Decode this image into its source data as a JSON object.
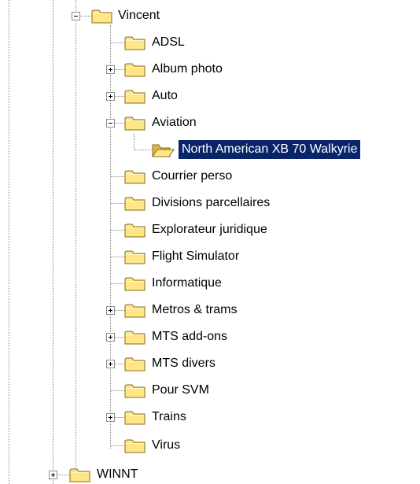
{
  "colors": {
    "selection_bg": "#0a246a",
    "selection_text": "#ffffff",
    "folder_fill": "#ffe788",
    "folder_outline": "#8a6a14",
    "connector": "#8a8a8a"
  },
  "tree": {
    "parent": {
      "label": "Vincent",
      "expander": "collapse",
      "icon": "folder-icon"
    },
    "children": [
      {
        "label": "ADSL",
        "expander": "none",
        "icon": "folder-icon"
      },
      {
        "label": "Album photo",
        "expander": "expand",
        "icon": "folder-icon"
      },
      {
        "label": "Auto",
        "expander": "expand",
        "icon": "folder-icon"
      },
      {
        "label": "Aviation",
        "expander": "collapse",
        "icon": "folder-icon"
      },
      {
        "label": "North American XB 70 Walkyrie",
        "expander": "none",
        "icon": "open-folder-icon",
        "selected": true
      },
      {
        "label": "Courrier perso",
        "expander": "none",
        "icon": "folder-icon"
      },
      {
        "label": "Divisions parcellaires",
        "expander": "none",
        "icon": "folder-icon"
      },
      {
        "label": "Explorateur juridique",
        "expander": "none",
        "icon": "folder-icon"
      },
      {
        "label": "Flight Simulator",
        "expander": "none",
        "icon": "folder-icon"
      },
      {
        "label": "Informatique",
        "expander": "none",
        "icon": "folder-icon"
      },
      {
        "label": "Metros & trams",
        "expander": "expand",
        "icon": "folder-icon"
      },
      {
        "label": "MTS add-ons",
        "expander": "expand",
        "icon": "folder-icon"
      },
      {
        "label": "MTS divers",
        "expander": "expand",
        "icon": "folder-icon"
      },
      {
        "label": "Pour SVM",
        "expander": "none",
        "icon": "folder-icon"
      },
      {
        "label": "Trains",
        "expander": "expand",
        "icon": "folder-icon"
      },
      {
        "label": "Virus",
        "expander": "none",
        "icon": "folder-icon"
      }
    ],
    "sibling": {
      "label": "WINNT",
      "expander": "expand",
      "icon": "folder-icon"
    }
  }
}
